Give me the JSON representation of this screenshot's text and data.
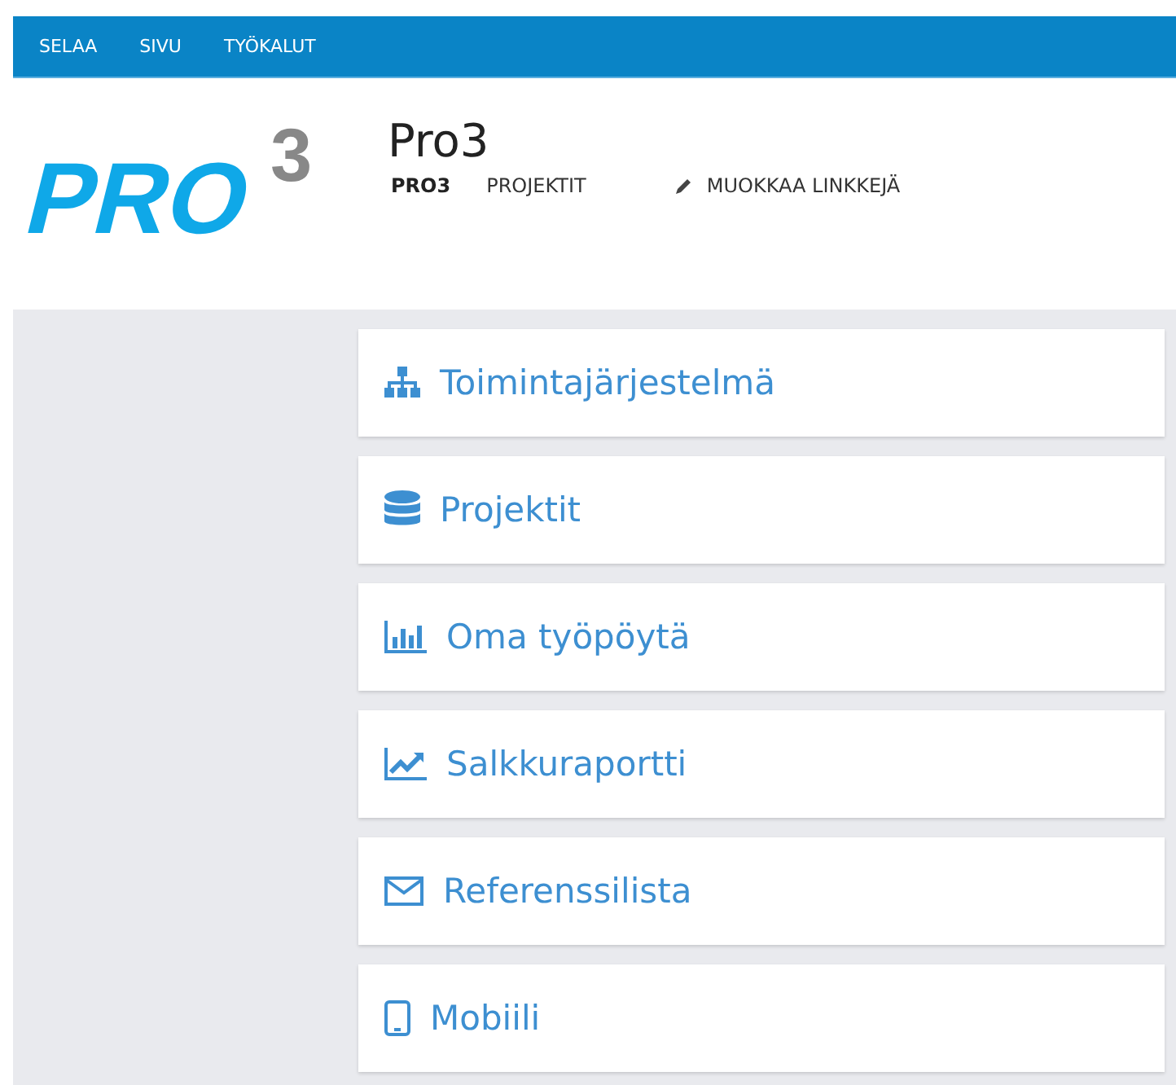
{
  "top_bar": {
    "items": [
      {
        "label": "SELAA"
      },
      {
        "label": "SIVU"
      },
      {
        "label": "TYÖKALUT"
      }
    ]
  },
  "header": {
    "logo": {
      "text": "PRO",
      "superscript": "3"
    },
    "title": "Pro3",
    "nav": [
      {
        "label": "PRO3",
        "selected": true
      },
      {
        "label": "PROJEKTIT",
        "selected": false
      }
    ],
    "edit_link": "MUOKKAA LINKKEJÄ"
  },
  "tiles": [
    {
      "label": "Toimintajärjestelmä"
    },
    {
      "label": "Projektit"
    },
    {
      "label": "Oma työpöytä"
    },
    {
      "label": "Salkkuraportti"
    },
    {
      "label": "Referenssilista"
    },
    {
      "label": "Mobiili"
    }
  ]
}
